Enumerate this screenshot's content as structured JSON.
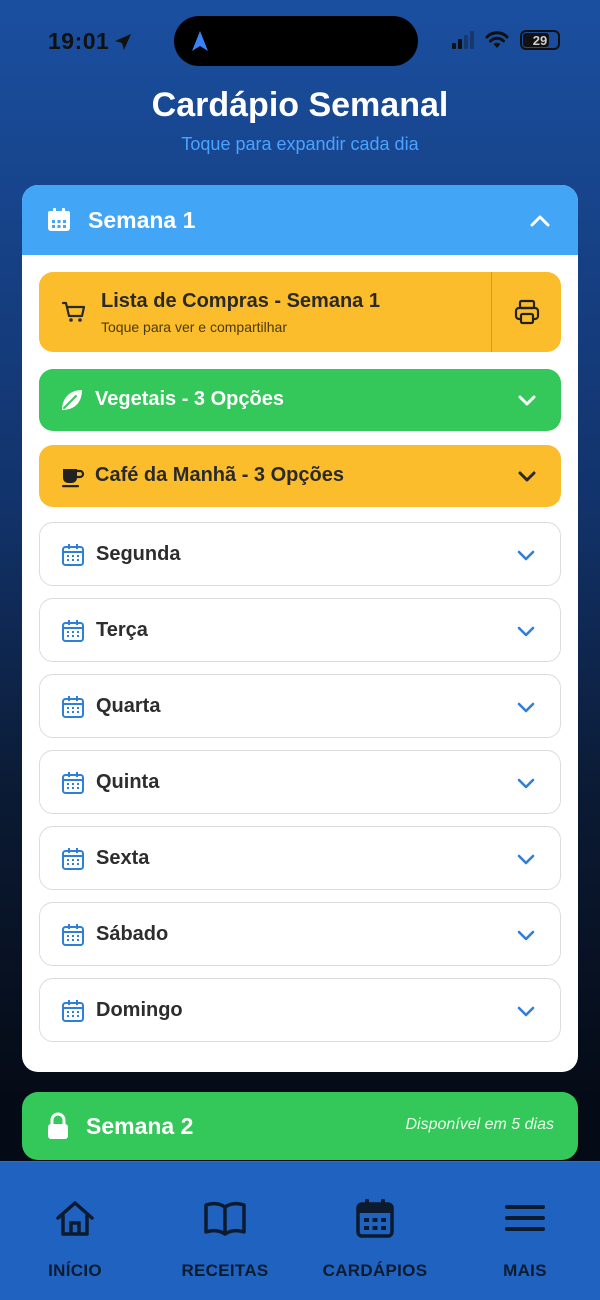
{
  "status_bar": {
    "time": "19:01",
    "battery": "29"
  },
  "header": {
    "title": "Cardápio Semanal",
    "subtitle": "Toque para expandir cada dia"
  },
  "week1": {
    "title": "Semana 1",
    "shopping": {
      "title": "Lista de Compras - Semana 1",
      "subtitle": "Toque para ver e compartilhar"
    },
    "vegetables_label": "Vegetais - 3 Opções",
    "breakfast_label": "Café da Manhã - 3 Opções",
    "days": [
      "Segunda",
      "Terça",
      "Quarta",
      "Quinta",
      "Sexta",
      "Sábado",
      "Domingo"
    ]
  },
  "week2": {
    "title": "Semana 2",
    "note": "Disponível em 5 dias"
  },
  "tabs": [
    {
      "label": "INÍCIO",
      "icon": "home-icon"
    },
    {
      "label": "RECEITAS",
      "icon": "book-icon"
    },
    {
      "label": "CARDÁPIOS",
      "icon": "calendar-icon"
    },
    {
      "label": "MAIS",
      "icon": "menu-icon"
    }
  ],
  "colors": {
    "blue_header": "#42a5f5",
    "green": "#34c759",
    "amber": "#fbbd2b",
    "tab_bar": "#1f62c0",
    "accent_blue": "#2f7fd6"
  }
}
